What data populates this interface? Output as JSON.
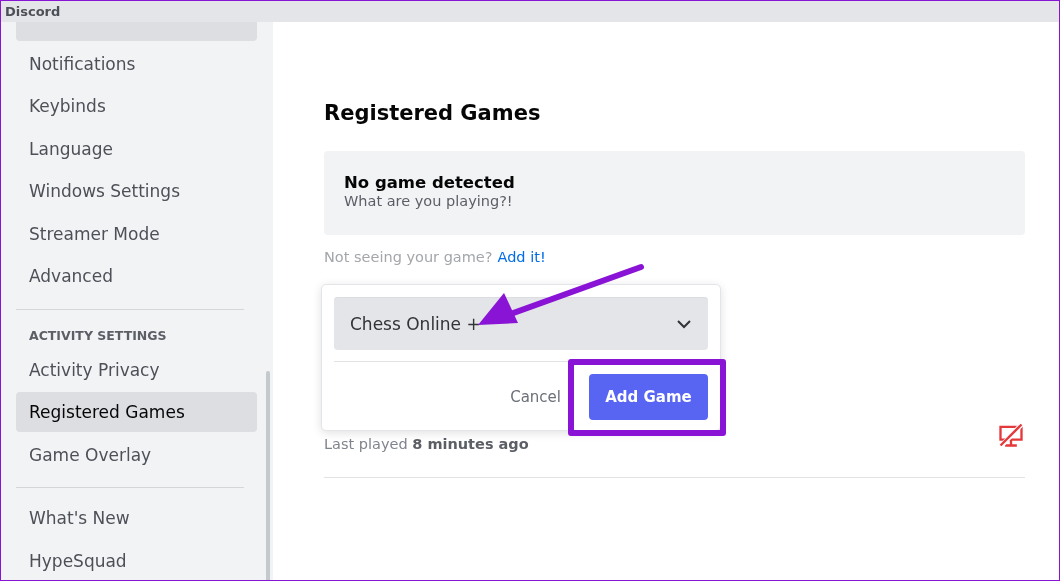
{
  "window": {
    "title": "Discord"
  },
  "sidebar": {
    "groups": [
      {
        "items": [
          {
            "label": "Notifications",
            "selected": false
          },
          {
            "label": "Keybinds",
            "selected": false
          },
          {
            "label": "Language",
            "selected": false
          },
          {
            "label": "Windows Settings",
            "selected": false
          },
          {
            "label": "Streamer Mode",
            "selected": false
          },
          {
            "label": "Advanced",
            "selected": false
          }
        ]
      },
      {
        "header": "ACTIVITY SETTINGS",
        "items": [
          {
            "label": "Activity Privacy",
            "selected": false
          },
          {
            "label": "Registered Games",
            "selected": true
          },
          {
            "label": "Game Overlay",
            "selected": false
          }
        ]
      },
      {
        "items": [
          {
            "label": "What's New",
            "selected": false
          },
          {
            "label": "HypeSquad",
            "selected": false
          }
        ]
      }
    ]
  },
  "main": {
    "heading": "Registered Games",
    "detected_card": {
      "title": "No game detected",
      "subtitle": "What are you playing?!"
    },
    "hint": {
      "text": "Not seeing your game?",
      "link": "Add it!"
    },
    "game_row": {
      "last_played": "Last played **8 minutes ago**",
      "overlay_enabled": false
    },
    "add_game_popup": {
      "selected_game": "Chess Online +",
      "cancel": "Cancel",
      "confirm": "Add Game"
    }
  }
}
